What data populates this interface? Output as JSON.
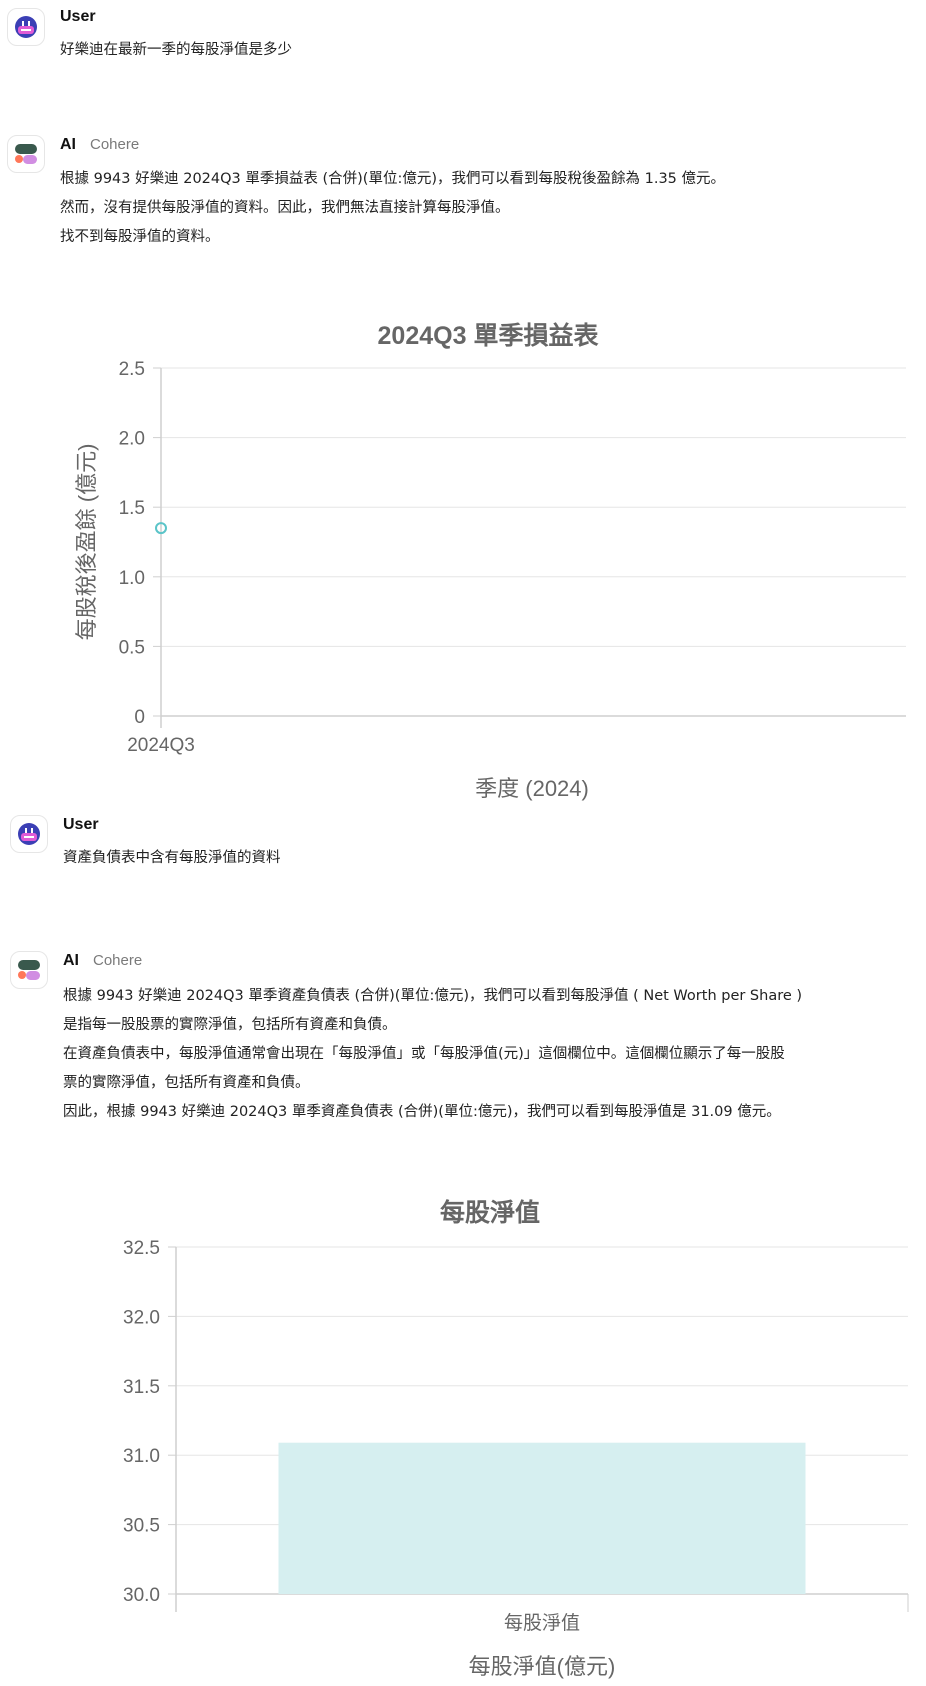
{
  "messages": [
    {
      "sender": "User",
      "text": "好樂迪在最新一季的每股淨值是多少"
    },
    {
      "sender": "AI",
      "model": "Cohere",
      "lines": [
        "根據 9943 好樂迪 2024Q3 單季損益表 (合併)(單位:億元)，我們可以看到每股稅後盈餘為 1.35 億元。",
        "然而，沒有提供每股淨值的資料。因此，我們無法直接計算每股淨值。",
        "找不到每股淨值的資料。"
      ]
    },
    {
      "sender": "User",
      "text": "資產負債表中含有每股淨值的資料"
    },
    {
      "sender": "AI",
      "model": "Cohere",
      "lines": [
        "根據 9943 好樂迪 2024Q3 單季資產負債表 (合併)(單位:億元)，我們可以看到每股淨值 ( Net Worth per Share )",
        "是指每一股股票的實際淨值，包括所有資產和負債。",
        "在資產負債表中，每股淨值通常會出現在「每股淨值」或「每股淨值(元)」這個欄位中。這個欄位顯示了每一股股",
        "票的實際淨值，包括所有資產和負債。",
        "因此，根據 9943 好樂迪 2024Q3 單季資產負債表 (合併)(單位:億元)，我們可以看到每股淨值是 31.09 億元。"
      ]
    }
  ],
  "icons": {
    "user_avatar": "robot-face-icon",
    "ai_avatar": "cohere-logo-icon"
  },
  "colors": {
    "accent": "#5bc4c8",
    "bar_fill": "#d6eff0",
    "grid": "#e5e5e5",
    "title": "#666666"
  },
  "chart_data": [
    {
      "type": "scatter",
      "title": "2024Q3 單季損益表",
      "xlabel": "季度 (2024)",
      "ylabel": "每股稅後盈餘 (億元)",
      "categories": [
        "2024Q3"
      ],
      "values": [
        1.35
      ],
      "ylim": [
        0,
        2.5
      ],
      "yticks": [
        "0",
        "0.5",
        "1.0",
        "1.5",
        "2.0",
        "2.5"
      ],
      "grid": true
    },
    {
      "type": "bar",
      "title": "每股淨值",
      "xlabel": "每股淨值(億元)",
      "ylabel": "",
      "categories": [
        "每股淨值"
      ],
      "values": [
        31.09
      ],
      "ylim": [
        30,
        32.5
      ],
      "yticks": [
        "30.0",
        "30.5",
        "31.0",
        "31.5",
        "32.0",
        "32.5"
      ],
      "grid": true
    }
  ]
}
